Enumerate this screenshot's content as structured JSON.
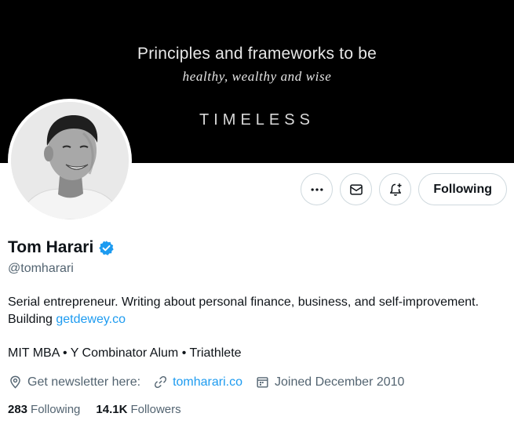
{
  "banner": {
    "line1": "Principles and frameworks to be",
    "line2": "healthy, wealthy and wise",
    "brand": "TIMELESS"
  },
  "profile": {
    "name": "Tom Harari",
    "verified_icon": "verified-badge-icon",
    "handle": "@tomharari",
    "bio_text": "Serial entrepreneur. Writing about personal finance, business, and self-improvement. Building ",
    "bio_link": "getdewey.co",
    "tagline": "MIT MBA • Y Combinator Alum • Triathlete"
  },
  "actions": {
    "more_icon": "more-icon",
    "message_icon": "mail-icon",
    "notify_icon": "bell-plus-icon",
    "follow_label": "Following"
  },
  "meta": {
    "location_icon": "location-pin-icon",
    "location_text": "Get newsletter here:",
    "website_icon": "link-icon",
    "website": "tomharari.co",
    "joined_icon": "calendar-icon",
    "joined": "Joined December 2010"
  },
  "stats": {
    "following_count": "283",
    "following_label": "Following",
    "followers_count": "14.1K",
    "followers_label": "Followers"
  },
  "colors": {
    "accent": "#1d9bf0",
    "text": "#0f1419",
    "secondary": "#536471",
    "border": "#cfd9de",
    "banner": "#000000"
  }
}
